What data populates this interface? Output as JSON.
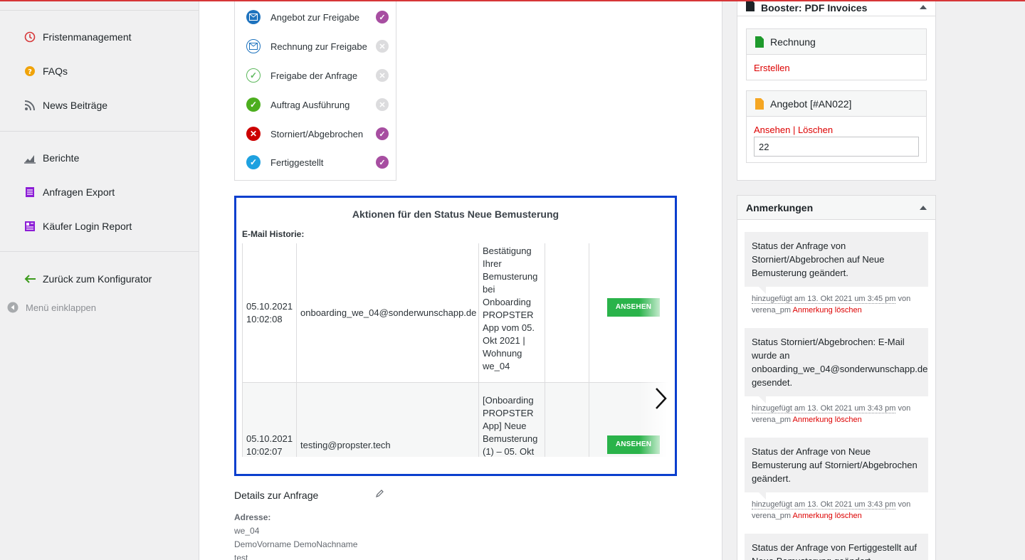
{
  "sidebar": {
    "items": [
      {
        "label": "Fristenmanagement",
        "icon": "clock-icon",
        "color": "#d63638"
      },
      {
        "label": "FAQs",
        "icon": "question-icon",
        "color": "#f0a30a"
      },
      {
        "label": "News Beiträge",
        "icon": "rss-icon",
        "color": "#646970"
      },
      {
        "label": "Berichte",
        "icon": "chart-icon",
        "color": "#646970"
      },
      {
        "label": "Anfragen Export",
        "icon": "export-icon",
        "color": "#8c1dd6"
      },
      {
        "label": "Käufer Login Report",
        "icon": "report-icon",
        "color": "#8c1dd6"
      },
      {
        "label": "Zurück zum Konfigurator",
        "icon": "arrow-left-icon",
        "color": "#3c9b1c"
      }
    ],
    "collapse_label": "Menü einklappen"
  },
  "statuses": [
    {
      "label": "Angebot zur Freigabe",
      "icon": "envelope-icon",
      "active": true
    },
    {
      "label": "Rechnung zur Freigabe",
      "icon": "envelope-outline-icon",
      "active": false
    },
    {
      "label": "Freigabe der Anfrage",
      "icon": "check-outline-icon",
      "active": false
    },
    {
      "label": "Auftrag Ausführung",
      "icon": "check-green-icon",
      "active": false
    },
    {
      "label": "Storniert/Abgebrochen",
      "icon": "x-red-icon",
      "active": true
    },
    {
      "label": "Fertiggestellt",
      "icon": "check-blue-icon",
      "active": true
    }
  ],
  "actions": {
    "title": "Aktionen für den Status Neue Bemusterung",
    "email_history_label": "E-Mail Historie:",
    "rows": [
      {
        "date": "05.10.2021",
        "time": "10:02:08",
        "email": "onboarding_we_04@sonderwunschapp.de",
        "subject_lines": [
          "Bestätigung",
          "Ihrer",
          "Bemusterung",
          "bei",
          "Onboarding",
          "PROPSTER",
          "App vom 05.",
          "Okt 2021 |",
          "Wohnung",
          "we_04"
        ],
        "button": "ANSEHEN"
      },
      {
        "date": "05.10.2021",
        "time": "10:02:07",
        "email": "testing@propster.tech",
        "subject_lines": [
          "[Onboarding",
          "PROPSTER",
          "App] Neue",
          "Bemusterung",
          "(1) – 05. Okt"
        ],
        "button": "ANSEHEN"
      }
    ]
  },
  "details": {
    "title": "Details zur Anfrage",
    "address_label": "Adresse:",
    "address_lines": [
      "we_04",
      "DemoVorname DemoNachname",
      "test"
    ]
  },
  "booster": {
    "title": "Booster: PDF Invoices",
    "invoice": {
      "title": "Rechnung",
      "action": "Erstellen"
    },
    "offer": {
      "title": "Angebot [#AN022]",
      "view": "Ansehen",
      "separator": " | ",
      "delete": "Löschen",
      "number": "22"
    }
  },
  "notes": {
    "title": "Anmerkungen",
    "items": [
      {
        "text": "Status der Anfrage von Storniert/Abgebrochen auf Neue Bemusterung geändert.",
        "added": "hinzugefügt am 13. Okt 2021 um 3:45 pm",
        "by": " von",
        "author": "verena_pm",
        "delete": "Anmerkung löschen"
      },
      {
        "text": "Status Storniert/Abgebrochen: E-Mail wurde an onboarding_we_04@sonderwunschapp.de gesendet.",
        "added": "hinzugefügt am 13. Okt 2021 um 3:43 pm",
        "by": " von",
        "author": "verena_pm",
        "delete": "Anmerkung löschen"
      },
      {
        "text": "Status der Anfrage von Neue Bemusterung auf Storniert/Abgebrochen geändert.",
        "added": "hinzugefügt am 13. Okt 2021 um 3:43 pm",
        "by": " von",
        "author": "verena_pm",
        "delete": "Anmerkung löschen"
      },
      {
        "text": "Status der Anfrage von Fertiggestellt auf Neue Bemusterung geändert."
      }
    ]
  }
}
